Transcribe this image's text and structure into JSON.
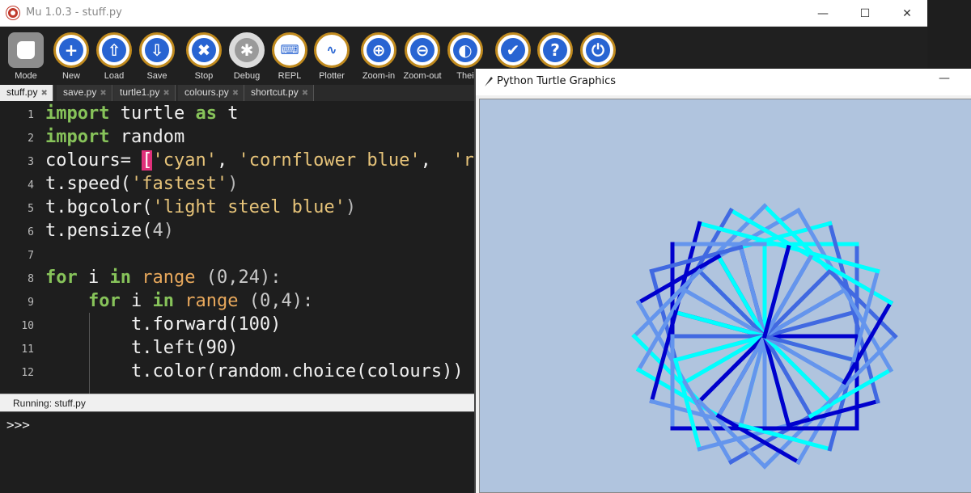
{
  "window": {
    "title": "Mu 1.0.3 - stuff.py"
  },
  "window_controls": {
    "minimize": "—",
    "maximize": "☐",
    "close": "✕"
  },
  "toolbar": {
    "buttons": [
      {
        "label": "Mode",
        "icon": "mode-icon",
        "glyph": ""
      },
      {
        "label": "New",
        "icon": "plus-icon",
        "glyph": "+"
      },
      {
        "label": "Load",
        "icon": "upload-icon",
        "glyph": "⇧"
      },
      {
        "label": "Save",
        "icon": "download-icon",
        "glyph": "⇩"
      },
      {
        "label": "Stop",
        "icon": "close-icon",
        "glyph": "✖"
      },
      {
        "label": "Debug",
        "icon": "bug-icon",
        "glyph": "✱"
      },
      {
        "label": "REPL",
        "icon": "keyboard-icon",
        "glyph": "⌨"
      },
      {
        "label": "Plotter",
        "icon": "pulse-icon",
        "glyph": "∿"
      },
      {
        "label": "Zoom-in",
        "icon": "zoom-in-icon",
        "glyph": "⊕"
      },
      {
        "label": "Zoom-out",
        "icon": "zoom-out-icon",
        "glyph": "⊖"
      },
      {
        "label": "Thei",
        "icon": "theme-icon",
        "glyph": "◐"
      },
      {
        "label": "",
        "icon": "thumbs-up-icon",
        "glyph": "✔"
      },
      {
        "label": "",
        "icon": "help-icon",
        "glyph": "?"
      },
      {
        "label": "",
        "icon": "power-icon",
        "glyph": "⏻"
      }
    ]
  },
  "tabs": [
    {
      "label": "stuff.py",
      "active": true
    },
    {
      "label": "save.py",
      "active": false
    },
    {
      "label": "turtle1.py",
      "active": false
    },
    {
      "label": "colours.py",
      "active": false
    },
    {
      "label": "shortcut.py",
      "active": false
    }
  ],
  "tab_close_glyph": "✖",
  "editor": {
    "line_numbers": [
      "1",
      "2",
      "3",
      "4",
      "5",
      "6",
      "7",
      "8",
      "9",
      "10",
      "11",
      "12"
    ],
    "l1": {
      "kw1": "import",
      "rest": " turtle ",
      "kw2": "as",
      "tail": " t"
    },
    "l2": {
      "kw1": "import",
      "rest": " random"
    },
    "l3": {
      "pre": "colours= ",
      "bracket": "[",
      "s1": "'cyan'",
      "sep": ", ",
      "s2": "'cornflower blue'",
      "sep2": ",  ",
      "s3": "'ro"
    },
    "l4": {
      "pre": "t.speed(",
      "s": "'fastest'",
      "post": ")"
    },
    "l5": {
      "pre": "t.bgcolor(",
      "s": "'light steel blue'",
      "post": ")"
    },
    "l6": {
      "pre": "t.pensize(",
      "n": "4",
      "post": ")"
    },
    "l8": {
      "kw1": "for",
      "mid": " i ",
      "kw2": "in",
      "fn": " range",
      "args": " (0,24):"
    },
    "l9": {
      "indent": "    ",
      "kw1": "for",
      "mid": " i ",
      "kw2": "in",
      "fn": " range",
      "args": " (0,4):"
    },
    "l10": {
      "indent": "        ",
      "code": "t.forward(100)"
    },
    "l11": {
      "indent": "        ",
      "code": "t.left(90)"
    },
    "l12": {
      "indent": "        ",
      "code": "t.color(random.choice(colours))"
    }
  },
  "status": {
    "text": "Running: stuff.py"
  },
  "repl": {
    "prompt": ">>>"
  },
  "turtle_window": {
    "title": "Python Turtle Graphics",
    "minimize": "—"
  },
  "colors": {
    "background": "#b0c4de",
    "cyan": "#00ffff",
    "cornflower_blue": "#6495ed",
    "royal_blue": "#4169e1",
    "medium_blue": "#0000cd"
  }
}
